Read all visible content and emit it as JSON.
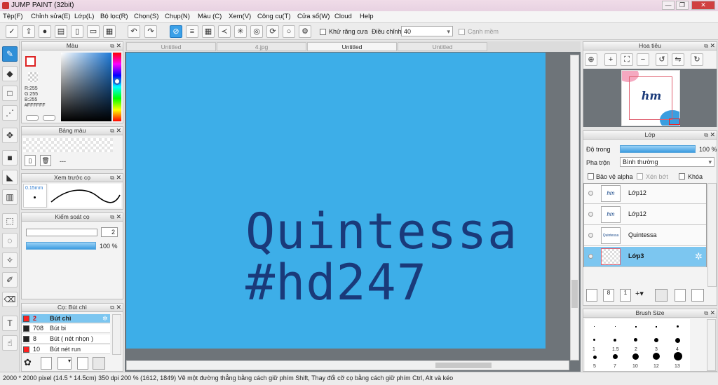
{
  "app": {
    "title": "JUMP PAINT (32bit)"
  },
  "menu": [
    "Tệp(F)",
    "Chỉnh sửa(E)",
    "Lớp(L)",
    "Bộ lọc(R)",
    "Chọn(S)",
    "Chụp(N)",
    "Màu (C)",
    "Xem(V)",
    "Công cụ(T)",
    "Cửa sổ(W)",
    "Cloud",
    "Help"
  ],
  "toolbar": {
    "antialias_label": "Khử răng cưa",
    "adjust_label": "Điều chỉnh",
    "adjust_value": "40",
    "edge_label": "Cạnh mềm"
  },
  "tabs": [
    "Untitled",
    "4.jpg",
    "Untitled",
    "Untitled"
  ],
  "color_panel": {
    "title": "Màu",
    "r": "R:255",
    "g": "G:255",
    "b": "B:255",
    "hex": "#FFFFFF"
  },
  "palette_panel": {
    "title": "Bảng màu",
    "value": "---"
  },
  "brush_preview": {
    "title": "Xem trước cọ",
    "size": "0.15mm"
  },
  "brush_control": {
    "title": "Kiểm soát cọ",
    "size": "2",
    "opacity": "100 %"
  },
  "pen_panel": {
    "title": "Cọ: Bút chì",
    "items": [
      {
        "num": "2",
        "name": "Bút chì",
        "color": "#ff2020"
      },
      {
        "num": "708",
        "name": "Bút bi",
        "color": "#222222"
      },
      {
        "num": "8",
        "name": "Bút ( nét nhọn )",
        "color": "#222222"
      },
      {
        "num": "10",
        "name": "Bút nét run",
        "color": "#ff2020"
      }
    ]
  },
  "canvas": {
    "line1": "Quintessa",
    "line2": "#hd247",
    "bg": "#3daee8",
    "text_color": "#1a3a7a"
  },
  "navigator": {
    "title": "Hoa tiêu",
    "thumb_text": "hm"
  },
  "layer_panel": {
    "title": "Lớp",
    "opacity_label": "Độ trong",
    "opacity_value": "100 %",
    "blend_label": "Pha trộn",
    "blend_value": "Bình thường",
    "protect_alpha": "Bảo vệ alpha",
    "clip": "Xén bớt",
    "lock": "Khóa",
    "layers": [
      {
        "name": "Lớp12",
        "thumb": "hm"
      },
      {
        "name": "Lớp12",
        "thumb": "hm"
      },
      {
        "name": "Quintessa",
        "thumb": "Quintessa"
      },
      {
        "name": "Lớp3",
        "thumb": ""
      }
    ]
  },
  "brush_size": {
    "title": "Brush Size",
    "row1": [
      "1",
      "1.5",
      "2",
      "3",
      "4",
      "5"
    ],
    "row2": [
      "5",
      "7",
      "10",
      "12",
      "13"
    ]
  },
  "status": {
    "text": "2000 * 2000 pixel   (14.5 * 14.5cm)   350 dpi   200 %   (1612, 1849)   Vẽ một đường thẳng bằng cách giữ phím Shift, Thay đổi cỡ cọ bằng cách giữ phím Ctrl, Alt và kéo"
  }
}
